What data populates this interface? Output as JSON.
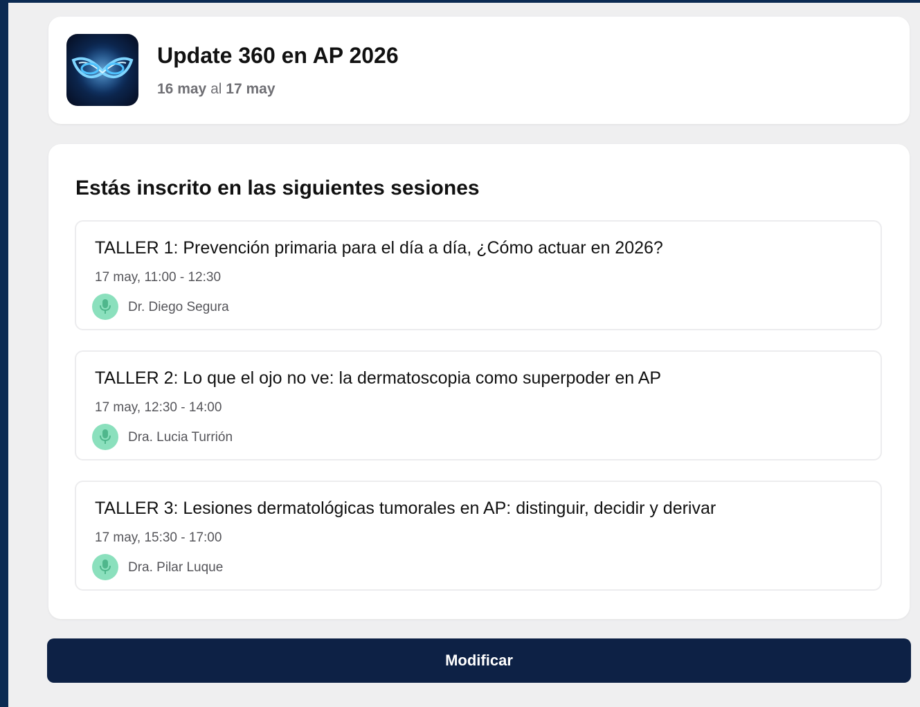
{
  "event": {
    "title": "Update 360 en AP 2026",
    "date_start": "16 may",
    "date_connector": "al",
    "date_end": "17 may",
    "logo_icon": "event-logo-icon"
  },
  "sessions_section": {
    "heading": "Estás inscrito en las siguientes sesiones"
  },
  "sessions": [
    {
      "title": "TALLER 1: Prevención primaria para el día a día, ¿Cómo actuar en 2026?",
      "time": "17 may, 11:00 - 12:30",
      "speaker": "Dr. Diego Segura",
      "speaker_icon": "microphone-icon"
    },
    {
      "title": "TALLER 2: Lo que el ojo no ve: la dermatoscopia como superpoder en AP",
      "time": "17 may, 12:30 - 14:00",
      "speaker": "Dra. Lucia Turrión",
      "speaker_icon": "microphone-icon"
    },
    {
      "title": "TALLER 3: Lesiones dermatológicas tumorales en AP: distinguir, decidir y derivar",
      "time": "17 may, 15:30 - 17:00",
      "speaker": "Dra. Pilar Luque",
      "speaker_icon": "microphone-icon"
    }
  ],
  "actions": {
    "modify_label": "Modificar"
  },
  "colors": {
    "outer_background": "#0b2a52",
    "page_background": "#efeff0",
    "button_background": "#0d2145",
    "speaker_icon_background": "#8be0bd"
  }
}
